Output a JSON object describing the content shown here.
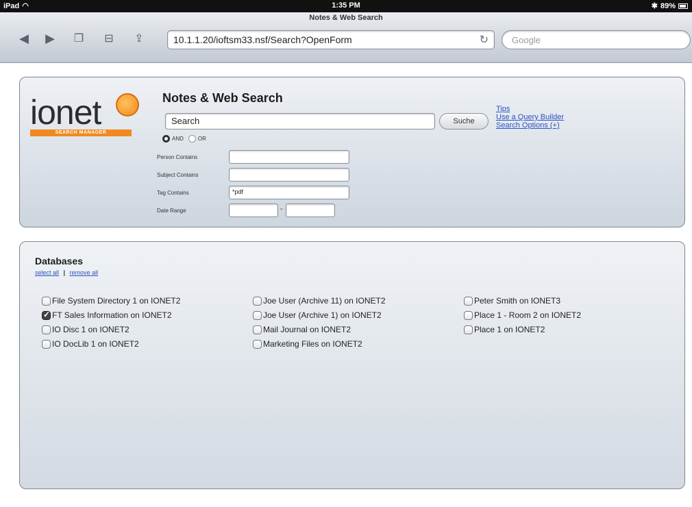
{
  "status": {
    "device": "iPad",
    "time": "1:35 PM",
    "battery": "89%"
  },
  "browser": {
    "title": "Notes & Web Search",
    "url": "10.1.1.20/ioftsm33.nsf/Search?OpenForm",
    "search_placeholder": "Google"
  },
  "logo": {
    "name": "ionet",
    "tagline": "SEARCH MANAGER"
  },
  "form": {
    "title": "Notes & Web Search",
    "query": "Search",
    "search_button": "Suche",
    "links": [
      "Tips",
      "Use a Query Builder",
      "Search Options (+)"
    ],
    "and_label": "AND",
    "or_label": "OR",
    "fields": [
      {
        "label": "Person Contains",
        "value": ""
      },
      {
        "label": "Subject Contains",
        "value": ""
      },
      {
        "label": "Tag Contains",
        "value": "*pdf"
      }
    ],
    "date_label": "Date Range",
    "date_separator": "-"
  },
  "databases": {
    "title": "Databases",
    "select_all": "select all",
    "separator": "|",
    "remove_all": "remove all",
    "columns": [
      [
        {
          "label": "File System Directory 1 on IONET2",
          "checked": false
        },
        {
          "label": "FT Sales Information on IONET2",
          "checked": true
        },
        {
          "label": "IO Disc 1 on IONET2",
          "checked": false
        },
        {
          "label": "IO DocLib 1 on IONET2",
          "checked": false
        }
      ],
      [
        {
          "label": "Joe User (Archive 11) on IONET2",
          "checked": false
        },
        {
          "label": "Joe User (Archive 1) on IONET2",
          "checked": false
        },
        {
          "label": "Mail Journal on IONET2",
          "checked": false
        },
        {
          "label": "Marketing Files on IONET2",
          "checked": false
        }
      ],
      [
        {
          "label": "Peter Smith on IONET3",
          "checked": false
        },
        {
          "label": "Place 1 - Room 2 on IONET2",
          "checked": false
        },
        {
          "label": "Place 1 on IONET2",
          "checked": false
        }
      ]
    ]
  }
}
